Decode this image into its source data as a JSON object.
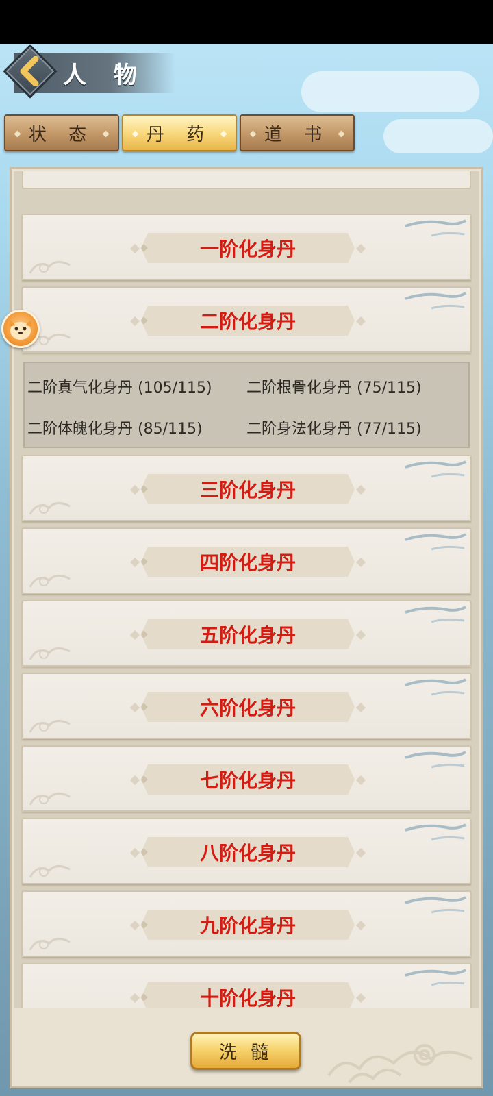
{
  "header": {
    "title": "人 物",
    "back_icon": "chevron-left-icon"
  },
  "tabs": [
    {
      "label": "状 态",
      "active": false
    },
    {
      "label": "丹 药",
      "active": true
    },
    {
      "label": "道 书",
      "active": false
    }
  ],
  "pills": [
    {
      "title": "一阶化身丹"
    },
    {
      "title": "二阶化身丹",
      "expanded": true
    },
    {
      "title": "三阶化身丹"
    },
    {
      "title": "四阶化身丹"
    },
    {
      "title": "五阶化身丹"
    },
    {
      "title": "六阶化身丹"
    },
    {
      "title": "七阶化身丹"
    },
    {
      "title": "八阶化身丹"
    },
    {
      "title": "九阶化身丹"
    },
    {
      "title": "十阶化身丹"
    }
  ],
  "detail": [
    "二阶真气化身丹 (105/115)",
    "二阶根骨化身丹 (75/115)",
    "二阶体魄化身丹 (85/115)",
    "二阶身法化身丹 (77/115)"
  ],
  "wash_button": "洗 髓",
  "colors": {
    "pill_title": "#d51c12",
    "tab_active": "#f8d97e",
    "tab_inactive": "#c59a6a"
  }
}
